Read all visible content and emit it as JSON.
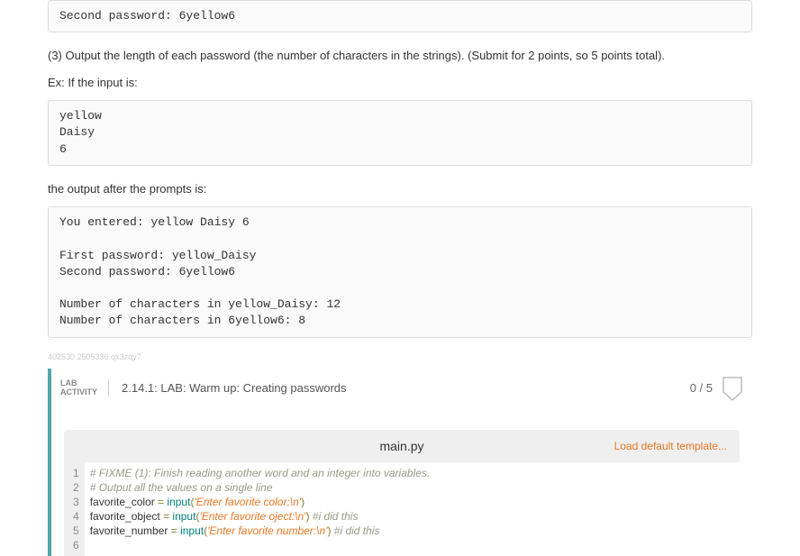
{
  "pre_top": "Second password: 6yellow6",
  "instruction_3": "(3) Output the length of each password (the number of characters in the strings). (Submit for 2 points, so 5 points total).",
  "ex_label": "Ex: If the input is:",
  "input_example": "yellow\nDaisy\n6",
  "after_prompts_label": "the output after the prompts is:",
  "output_example": "You entered: yellow Daisy 6\n\nFirst password: yellow_Daisy\nSecond password: 6yellow6\n\nNumber of characters in yellow_Daisy: 12\nNumber of characters in 6yellow6: 8",
  "watermark": "402530.2505336.qx3zqy7",
  "lab": {
    "label_line1": "LAB",
    "label_line2": "ACTIVITY",
    "title": "2.14.1: LAB: Warm up: Creating passwords",
    "score": "0 / 5"
  },
  "editor": {
    "filename": "main.py",
    "load_template": "Load default template...",
    "gutter": [
      "1",
      "2",
      "3",
      "4",
      "5",
      "6"
    ],
    "lines": {
      "l1_comment": "# FIXME (1): Finish reading another word and an integer into variables.",
      "l2_comment": "# Output all the values on a single line",
      "l3_var": "favorite_color",
      "l3_eq": " = ",
      "l3_fn": "input",
      "l3_open": "(",
      "l3_str": "'Enter favorite color:\\n'",
      "l3_close": ")",
      "l4_var": "favorite_object",
      "l4_eq": " = ",
      "l4_fn": "input",
      "l4_open": "(",
      "l4_str": "'Enter favorite oject:\\n'",
      "l4_close": ") ",
      "l4_comment": "#i did this",
      "l5_var": "favorite_number",
      "l5_eq": " = ",
      "l5_fn": "input",
      "l5_open": "(",
      "l5_str": "'Enter favorite number:\\n'",
      "l5_close": ") ",
      "l5_comment": "#i did this"
    }
  }
}
